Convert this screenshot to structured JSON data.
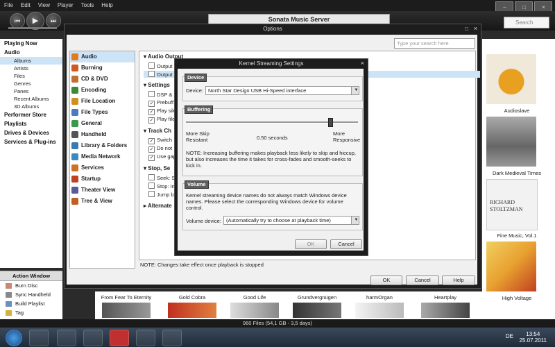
{
  "menubar": {
    "items": [
      "File",
      "Edit",
      "View",
      "Player",
      "Tools",
      "Help"
    ]
  },
  "app": {
    "title": "Sonata Music Server",
    "search_placeholder": "Search"
  },
  "sidebar": {
    "playing_now": "Playing Now",
    "audio": "Audio",
    "audio_items": [
      "Albums",
      "Artists",
      "Files",
      "Genres",
      "Panes",
      "Recent Albums",
      "3D Albums"
    ],
    "sections": [
      "Performer Store",
      "Playlists",
      "Drives & Devices",
      "Services & Plug-ins"
    ]
  },
  "action_window": {
    "title": "Action Window",
    "items": [
      "Burn Disc",
      "Sync Handheld",
      "Build Playlist",
      "Tag"
    ]
  },
  "albums_right": [
    {
      "title": "Audioslave"
    },
    {
      "title": "Dark Medieval Times"
    },
    {
      "title": "Fine Music, Vol.1",
      "cover_text": [
        "RICHARD",
        "STOLTZMAN"
      ]
    },
    {
      "title": "High Voltage"
    }
  ],
  "albums_bottom": [
    "From Fear To Eternity",
    "Gold Cobra",
    "Good Life",
    "Grundvergnügen",
    "harmOrgan",
    "Heartplay"
  ],
  "status": "960 Files (54,1 GB - 3,5 days)",
  "options": {
    "title": "Options",
    "search_placeholder": "Type your search here",
    "nav": [
      "Audio",
      "Burning",
      "CD & DVD",
      "Encoding",
      "File Location",
      "File Types",
      "General",
      "Handheld",
      "Library & Folders",
      "Media Network",
      "Services",
      "Startup",
      "Theater View",
      "Tree & View"
    ],
    "nav_colors": [
      "#e07b20",
      "#d05a20",
      "#c07030",
      "#3a8a3a",
      "#d09020",
      "#4a7ac0",
      "#3a9a4a",
      "#555555",
      "#3a7ab0",
      "#3a8ac0",
      "#d07020",
      "#c04020",
      "#5a5a9a",
      "#c06020"
    ],
    "groups": {
      "audio_output": "Audio Output",
      "audio_output_rows": [
        "Output",
        "Output"
      ],
      "settings": "Settings",
      "settings_rows": [
        "DSP &",
        "Prebuff",
        "Play sile",
        "Play file"
      ],
      "track_change": "Track Ch",
      "track_rows": [
        "Switch",
        "Do not",
        "Use gap"
      ],
      "stop_seek": "Stop, Se",
      "stop_rows": [
        "Seek: Sn",
        "Stop: In",
        "Jump b"
      ],
      "alternate": "Alternate"
    },
    "note": "NOTE: Changes take effect once playback is stopped",
    "ok": "OK",
    "cancel": "Cancel",
    "help": "Help"
  },
  "ks": {
    "title": "Kernel Streaming Settings",
    "device_header": "Device",
    "device_label": "Device:",
    "device_value": "North Star Design USB Hi-Speed interface",
    "buffering_header": "Buffering",
    "left_label_1": "More Skip",
    "left_label_2": "Resistant",
    "buffer_value": "0.50 seconds",
    "right_label_1": "More",
    "right_label_2": "Responsive",
    "slider_level": 0.84,
    "buffer_note": "NOTE: Increasing buffering makes playback less likely to skip and hiccup, but also increases the time it takes for cross-fades and smooth-seeks to kick in.",
    "volume_header": "Volume",
    "volume_note": "Kernel streaming device names do not always match Windows device names.  Please select the corresponding Windows device for volume control.",
    "volume_label": "Volume device:",
    "volume_value": "(Automatically try to choose at playback time)",
    "ok": "OK",
    "cancel": "Cancel"
  },
  "taskbar": {
    "lang": "DE",
    "time": "13:54",
    "date": "25.07.2011"
  }
}
